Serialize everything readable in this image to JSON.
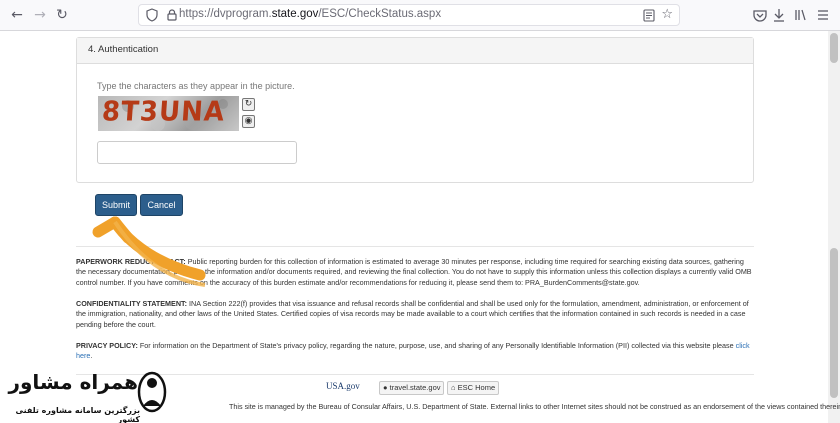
{
  "browser": {
    "url_prefix": "https://dvprogram.",
    "url_domain": "state.gov",
    "url_path": "/ESC/CheckStatus.aspx",
    "nav_icons": [
      "back-icon",
      "forward-icon",
      "reload-icon"
    ],
    "tool_icons": [
      "pocket-icon",
      "download-icon",
      "library-icon",
      "reader-view-icon",
      "menu-icon"
    ]
  },
  "section": {
    "heading": "4. Authentication",
    "instruction": "Type the characters as they appear in the picture.",
    "captcha_text": "8T3UNA",
    "captcha_input_value": ""
  },
  "buttons": {
    "submit": "Submit",
    "cancel": "Cancel"
  },
  "notices": {
    "paperwork_label": "PAPERWORK REDUCTION ACT:",
    "paperwork_text": "Public reporting burden for this collection of information is estimated to average 30 minutes per response, including time required for searching existing data sources, gathering the necessary documentation, providing the information and/or documents required, and reviewing the final collection. You do not have to supply this information unless this collection displays a currently valid OMB control number. If you have comments on the accuracy of this burden estimate and/or recommendations for reducing it, please send them to: PRA_BurdenComments@state.gov.",
    "confidentiality_label": "CONFIDENTIALITY STATEMENT:",
    "confidentiality_text": "INA Section 222(f) provides that visa issuance and refusal records shall be confidential and shall be used only for the formulation, amendment, administration, or enforcement of the immigration, nationality, and other laws of the United States. Certified copies of visa records may be made available to a court which certifies that the information contained in such records is needed in a case pending before the court.",
    "privacy_label": "PRIVACY POLICY:",
    "privacy_text": "For information on the Department of State's privacy policy, regarding the nature, purpose, use, and sharing of any Personally Identifiable Information (PII) collected via this website please",
    "privacy_link": "click here",
    "privacy_end": "."
  },
  "footer": {
    "usa_logo_text": "USA",
    "usa_logo_suffix": ".gov",
    "travel_link": "travel.state.gov",
    "esc_home_link": "ESC Home",
    "disclaimer": "This site is managed by the Bureau of Consular Affairs, U.S. Department of State. External links to other Internet sites should not be construed as an endorsement of the views contained therein."
  },
  "watermark": {
    "title": "همراه مشاور",
    "subtitle": "بزرگترین سامانه مشاوره تلفنی کشور"
  },
  "colors": {
    "button_bg": "#2c5e8c",
    "arrow": "#f0a12a",
    "captcha_text": "#b53a17",
    "link": "#2a6fb5"
  }
}
